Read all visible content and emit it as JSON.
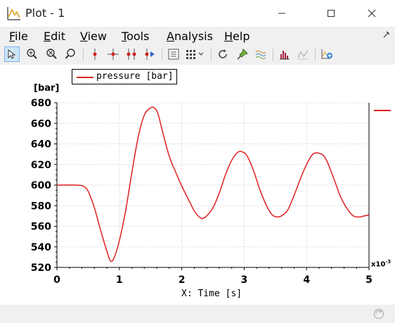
{
  "window": {
    "title": "Plot - 1"
  },
  "menu": [
    {
      "label": "File",
      "mnemonic": "F",
      "rest": "ile"
    },
    {
      "label": "Edit",
      "mnemonic": "E",
      "rest": "dit"
    },
    {
      "label": "View",
      "mnemonic": "V",
      "rest": "iew"
    },
    {
      "label": "Tools",
      "mnemonic": "T",
      "rest": "ools"
    },
    {
      "label": "Analysis",
      "mnemonic": "A",
      "rest": "nalysis"
    },
    {
      "label": "Help",
      "mnemonic": "H",
      "rest": "elp"
    }
  ],
  "toolbar": {
    "tools": [
      "select-pointer-icon",
      "zoom-in-icon",
      "zoom-out-icon",
      "zoom-reset-icon",
      "marker-icon",
      "crosshair-icon",
      "dual-marker-icon",
      "marker-next-icon",
      "properties-icon",
      "grid-dropdown-icon",
      "refresh-icon",
      "pin-icon",
      "waves-icon",
      "histogram-icon",
      "plot-disabled-icon",
      "add-plot-icon"
    ],
    "active": "select-pointer-icon"
  },
  "colors": {
    "series": "#e02020",
    "grid": "#c8c8c8",
    "titlebar": "#ffffff",
    "chrome": "#f0f0f0"
  },
  "chart_data": {
    "type": "line",
    "ylabel_unit": "[bar]",
    "xlabel": "X: Time [s]",
    "x_exponent_base": "x10",
    "x_exponent_power": "-3",
    "xlim": [
      0,
      5
    ],
    "ylim": [
      520,
      680
    ],
    "x_ticks": [
      0,
      1,
      2,
      3,
      4,
      5
    ],
    "y_ticks": [
      520,
      540,
      560,
      580,
      600,
      620,
      640,
      660,
      680
    ],
    "grid": true,
    "legend_position": "top-left",
    "series": [
      {
        "name": "pressure [bar]",
        "color": "#e02020",
        "x": [
          0.0,
          0.3,
          0.42,
          0.5,
          0.6,
          0.7,
          0.8,
          0.86,
          0.92,
          1.0,
          1.1,
          1.2,
          1.3,
          1.4,
          1.5,
          1.56,
          1.62,
          1.7,
          1.8,
          1.9,
          2.0,
          2.1,
          2.2,
          2.3,
          2.35,
          2.4,
          2.5,
          2.6,
          2.7,
          2.8,
          2.9,
          2.98,
          3.05,
          3.15,
          3.25,
          3.35,
          3.45,
          3.55,
          3.62,
          3.7,
          3.8,
          3.9,
          4.0,
          4.1,
          4.2,
          4.28,
          4.35,
          4.45,
          4.55,
          4.65,
          4.75,
          4.85,
          4.92,
          5.0
        ],
        "y": [
          600,
          600,
          599,
          594,
          578,
          556,
          536,
          526,
          530,
          546,
          575,
          612,
          646,
          668,
          675,
          675,
          669,
          650,
          628,
          613,
          599,
          587,
          575,
          568,
          568,
          570,
          578,
          592,
          610,
          624,
          632,
          632,
          628,
          614,
          596,
          581,
          571,
          569,
          571,
          576,
          590,
          606,
          620,
          630,
          631,
          628,
          620,
          604,
          588,
          577,
          570,
          569,
          570,
          571
        ]
      }
    ]
  }
}
